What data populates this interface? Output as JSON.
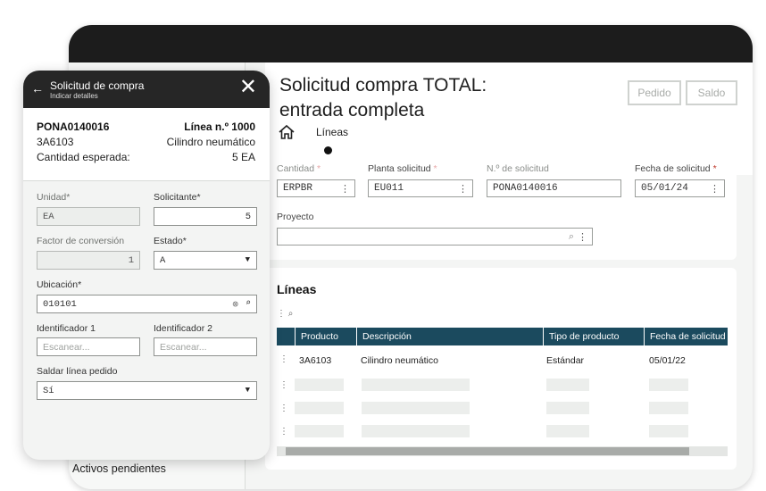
{
  "main": {
    "page_title_line1": "Solicitud compra TOTAL:",
    "page_title_line2": "entrada completa",
    "buttons": {
      "pedido": "Pedido",
      "saldo": "Saldo"
    },
    "tab": "Líneas",
    "left_nav_item": "Activos pendientes"
  },
  "form": {
    "cantidad": {
      "label": "Cantidad",
      "value": "ERPBR"
    },
    "planta": {
      "label": "Planta solicitud",
      "value": "EU011"
    },
    "num_solicitud": {
      "label": "N.º de solicitud",
      "value": "PONA0140016"
    },
    "fecha": {
      "label": "Fecha de solicitud",
      "value": "05/01/24"
    },
    "proyecto": {
      "label": "Proyecto",
      "value": ""
    },
    "required_mark": "*"
  },
  "lines": {
    "title": "Líneas",
    "columns": [
      "Producto",
      "Descripción",
      "Tipo de producto",
      "Fecha de solicitud"
    ],
    "rows": [
      [
        "3A6103",
        "Cilindro neumático",
        "Estándar",
        "05/01/22"
      ]
    ]
  },
  "panel": {
    "title": "Solicitud de compra",
    "subtitle": "Indicar detalles",
    "order_id": "PONA0140016",
    "line_no": "Línea n.º 1000",
    "product_code": "3A6103",
    "product_desc": "Cilindro neumático",
    "qty_label": "Cantidad esperada:",
    "qty_value": "5 EA",
    "fields": {
      "unidad": {
        "label": "Unidad*",
        "value": "EA"
      },
      "solicitante": {
        "label": "Solicitante*",
        "value": "5"
      },
      "factor": {
        "label": "Factor de conversión",
        "value": "1"
      },
      "estado": {
        "label": "Estado*",
        "value": "A"
      },
      "ubicacion": {
        "label": "Ubicación*",
        "value": "010101"
      },
      "id1": {
        "label": "Identificador 1",
        "placeholder": "Escanear..."
      },
      "id2": {
        "label": "Identificador 2",
        "placeholder": "Escanear..."
      },
      "saldar": {
        "label": "Saldar línea pedido",
        "value": "Sí"
      }
    }
  },
  "colors": {
    "table_header": "#1b4a5e",
    "panel_header": "#262626",
    "required": "#c0392b"
  }
}
